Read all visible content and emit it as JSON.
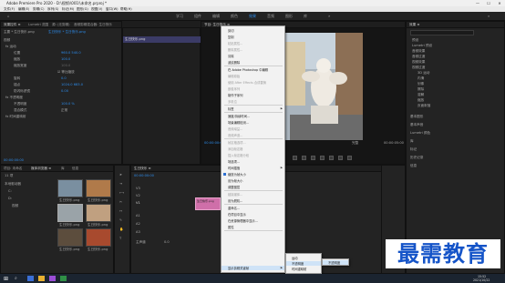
{
  "app": {
    "title": "Adobe Premiere Pro 2020 - D:\\视频\\\\001\\\\未命名.prproj *",
    "window_controls": [
      "—",
      "☐",
      "✕"
    ]
  },
  "menubar": [
    "文件(F)",
    "编辑(E)",
    "剪辑(C)",
    "序列(S)",
    "标记(M)",
    "图形(G)",
    "视图(V)",
    "窗口(W)",
    "帮助(H)"
  ],
  "workspaces": {
    "items": [
      "学习",
      "组件",
      "编辑",
      "颜色",
      "效果",
      "音频",
      "图形",
      "库"
    ],
    "active_index": 4
  },
  "effect_controls": {
    "tabs": [
      "效果控件 ≡",
      "Lumetri 范围",
      "源: (无剪辑)",
      "音频剪辑混合器: 生日快乐"
    ],
    "clip_path": "主要 * 生日快乐.png",
    "sequence": "生日快乐 * 生日快乐.png",
    "rows": [
      {
        "label": "视频",
        "value": ""
      },
      {
        "label": "fx 运动",
        "value": ""
      },
      {
        "label": "位置",
        "value": "960.0  540.0"
      },
      {
        "label": "缩放",
        "value": "100.0"
      },
      {
        "label": "缩放宽度",
        "value": "100.0"
      },
      {
        "label": "",
        "value": "☑ 等比缩放"
      },
      {
        "label": "旋转",
        "value": "0.0"
      },
      {
        "label": "锚点",
        "value": "1024.0  683.0"
      },
      {
        "label": "防闪烁滤镜",
        "value": "0.00"
      },
      {
        "label": "fx 不透明度",
        "value": ""
      },
      {
        "label": "不透明度",
        "value": "100.0 %"
      },
      {
        "label": "混合模式",
        "value": "正常"
      },
      {
        "label": "fx 时间重映射",
        "value": ""
      }
    ],
    "timecode": "00:00:00:00",
    "clip_label": "生日快乐.png"
  },
  "program_monitor": {
    "tab": "节目: 生日快乐 ≡",
    "timecode": "00:00:00:00",
    "fit": "完整",
    "duration": "00:00:05:00"
  },
  "right_panel": {
    "title": "效果 ≡",
    "search": "",
    "items": [
      "预设",
      "Lumetri 预设",
      "音频效果",
      "音频过渡",
      "视频效果",
      "视频过渡",
      "3D 运动",
      "内滑",
      "划像",
      "擦除",
      "溶解",
      "缩放",
      "页面剥落"
    ],
    "bottom": [
      "基本图形",
      "基本声音",
      "Lumetri 颜色",
      "库",
      "标记",
      "历史记录",
      "信息"
    ]
  },
  "project_panel": {
    "tabs": [
      "项目: 未命名",
      "媒体浏览器 ≡",
      "库",
      "信息"
    ],
    "count": "11 项",
    "folders": [
      "本地驱动器",
      "C:",
      "D:",
      "视频"
    ],
    "thumbs": [
      "生日快乐.png",
      "生日快乐.png",
      "生日快乐.png",
      "生日快乐.png",
      "生日快乐.png",
      "生日快乐.png"
    ]
  },
  "timeline": {
    "tab": "生日快乐 ≡",
    "timecode": "00:00:00:00",
    "tracks": [
      "V3",
      "V2",
      "V1",
      "A1",
      "A2",
      "A3",
      "主声道"
    ],
    "clip": "生日快乐.png",
    "master_value": "0.0"
  },
  "context_menu": {
    "items": [
      {
        "label": "剪切",
        "state": "normal"
      },
      {
        "label": "复制",
        "state": "normal"
      },
      {
        "label": "粘贴属性...",
        "state": "disabled"
      },
      {
        "label": "删除属性...",
        "state": "disabled"
      },
      {
        "label": "清除",
        "state": "normal"
      },
      {
        "label": "波纹删除",
        "state": "normal"
      },
      {
        "label": "在 Adobe Photoshop 中编辑",
        "state": "normal"
      },
      {
        "label": "编辑原始",
        "state": "disabled"
      },
      {
        "label": "使用 After Effects 合成替换",
        "state": "disabled"
      },
      {
        "label": "嵌套序列",
        "state": "disabled"
      },
      {
        "label": "制作子序列",
        "state": "normal"
      },
      {
        "label": "多机位",
        "state": "disabled"
      },
      {
        "label": "标签",
        "state": "normal",
        "submenu": true
      },
      {
        "label": "速度/持续时间...",
        "state": "normal"
      },
      {
        "label": "场景编辑检测...",
        "state": "normal"
      },
      {
        "label": "音频增益...",
        "state": "disabled"
      },
      {
        "label": "音频声道...",
        "state": "disabled"
      },
      {
        "label": "帧定格选项...",
        "state": "disabled"
      },
      {
        "label": "添加帧定格",
        "state": "disabled"
      },
      {
        "label": "插入帧定格分段",
        "state": "disabled"
      },
      {
        "label": "场选项...",
        "state": "normal"
      },
      {
        "label": "时间插值",
        "state": "normal",
        "submenu": true
      },
      {
        "label": "缩放为帧大小",
        "state": "checked"
      },
      {
        "label": "设为帧大小",
        "state": "normal"
      },
      {
        "label": "调整图层",
        "state": "normal"
      },
      {
        "label": "链接媒体...",
        "state": "disabled"
      },
      {
        "label": "设为脱机...",
        "state": "normal"
      },
      {
        "label": "重命名...",
        "state": "normal"
      },
      {
        "label": "在项目中显示",
        "state": "normal"
      },
      {
        "label": "在资源管理器中显示...",
        "state": "normal"
      },
      {
        "label": "属性",
        "state": "normal"
      },
      {
        "label": "显示剪辑关键帧",
        "state": "highlight",
        "submenu": true
      }
    ],
    "submenu1": [
      "运动",
      "不透明度",
      "时间重映射"
    ],
    "submenu2": [
      "不透明度"
    ]
  },
  "taskbar": {
    "time": "15:52",
    "date": "2021/10/22"
  },
  "watermark": "最需教育"
}
